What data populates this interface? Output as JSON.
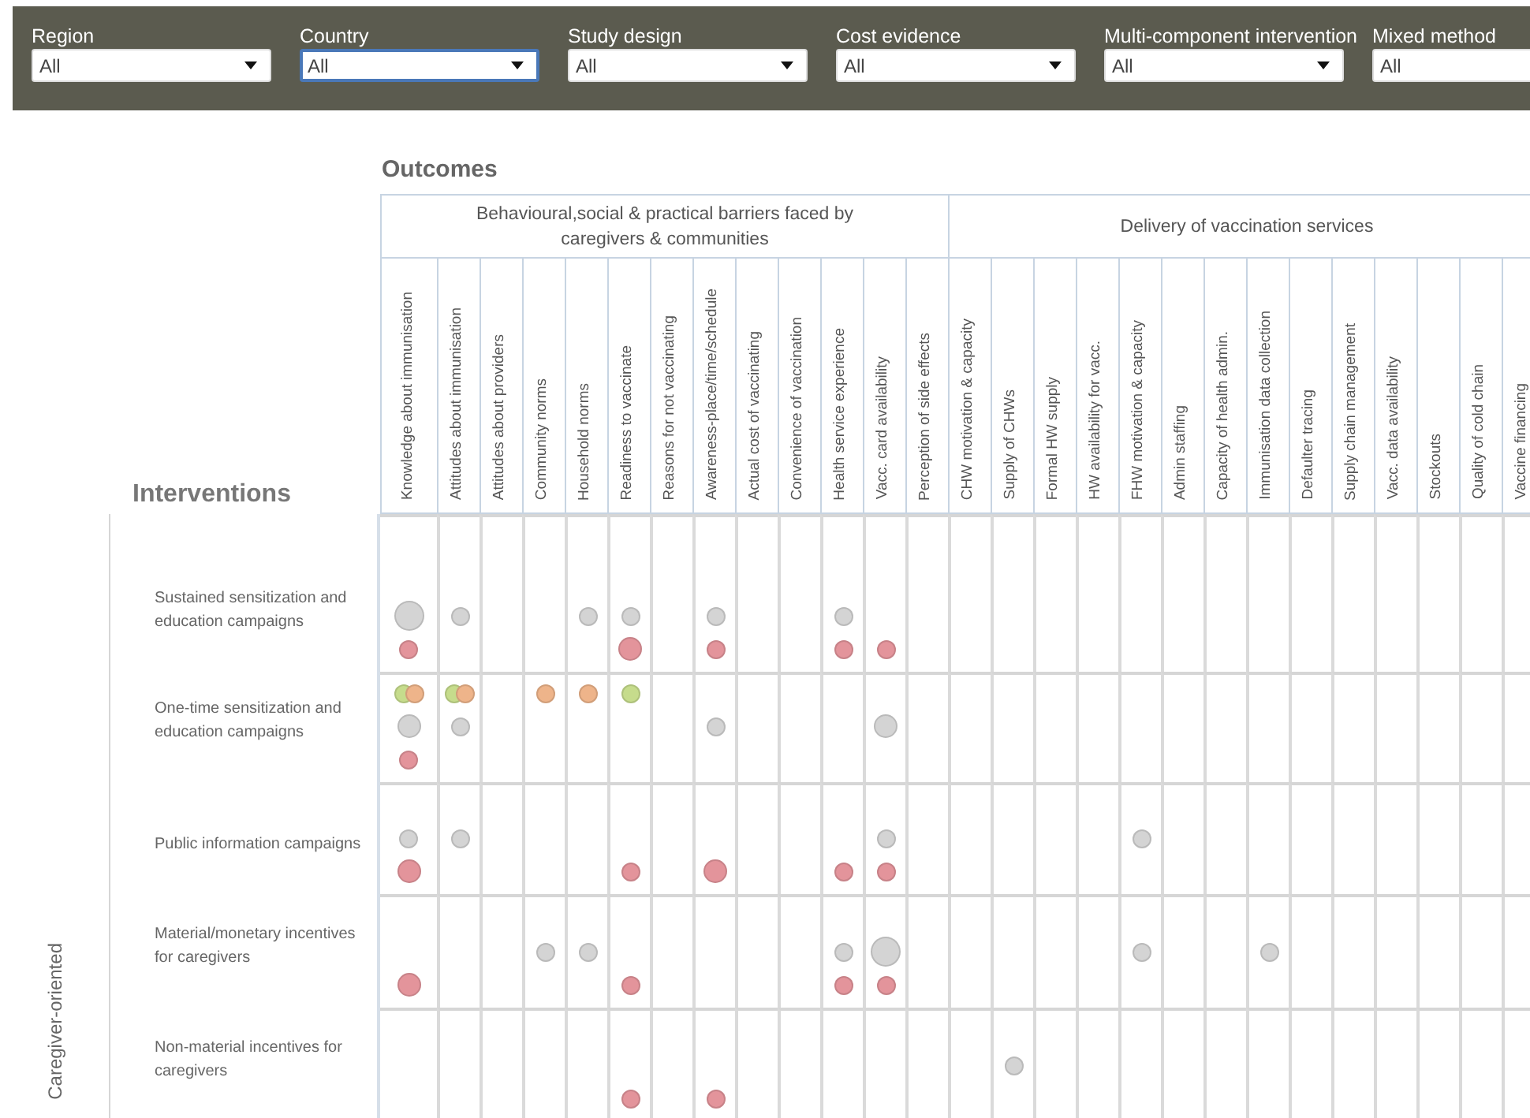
{
  "filters": [
    {
      "label": "Region",
      "value": "All",
      "focused": false
    },
    {
      "label": "Country",
      "value": "All",
      "focused": true
    },
    {
      "label": "Study design",
      "value": "All",
      "focused": false
    },
    {
      "label": "Cost evidence",
      "value": "All",
      "focused": false
    },
    {
      "label": "Multi-component intervention",
      "value": "All",
      "focused": false
    },
    {
      "label": "Mixed method",
      "value": "All",
      "focused": false
    }
  ],
  "outcomes_title": "Outcomes",
  "interventions_title": "Interventions",
  "outcome_groups": [
    {
      "title": "Behavioural,social & practical barriers faced by caregivers & communities",
      "columns": [
        "Knowledge about immunisation",
        "Attitudes about immunisation",
        "Attitudes about providers",
        "Community norms",
        "Household norms",
        "Readiness to vaccinate",
        "Reasons for not vaccinating",
        "Awareness-place/time/schedule",
        "Actual cost of vaccinating",
        "Convenience of vaccination",
        "Health service experience",
        "Vacc. card availability",
        "Perception of side effects"
      ]
    },
    {
      "title": "Delivery of vaccination services",
      "columns": [
        "CHW motivation & capacity",
        "Supply of CHWs",
        "Formal HW supply",
        "HW availability for vacc.",
        "FHW motivation & capacity",
        "Admin staffing",
        "Capacity of health admin.",
        "Immunisation data collection",
        "Defaulter tracing",
        "Supply chain management",
        "Vacc. data availability",
        "Stockouts",
        "Quality of cold chain",
        "Vaccine financing"
      ]
    }
  ],
  "intervention_groups": [
    {
      "title": "Caregiver-oriented",
      "rows": [
        {
          "label": "Sustained sensitization and education campaigns",
          "cells": [
            {
              "middle": [
                {
                  "color": "#d4d4d4",
                  "kind": "large"
                }
              ],
              "bottom": [
                {
                  "color": "#e3949b",
                  "kind": "small"
                }
              ]
            },
            {
              "middle": [
                {
                  "color": "#d4d4d4",
                  "kind": "small"
                }
              ]
            },
            {},
            {},
            {
              "middle": [
                {
                  "color": "#d4d4d4",
                  "kind": "small"
                }
              ]
            },
            {
              "middle": [
                {
                  "color": "#d4d4d4",
                  "kind": "small"
                }
              ],
              "bottom": [
                {
                  "color": "#e3949b",
                  "kind": "medium"
                }
              ]
            },
            {},
            {
              "middle": [
                {
                  "color": "#d4d4d4",
                  "kind": "small"
                }
              ],
              "bottom": [
                {
                  "color": "#e3949b",
                  "kind": "small"
                }
              ]
            },
            {},
            {},
            {
              "middle": [
                {
                  "color": "#d4d4d4",
                  "kind": "small"
                }
              ],
              "bottom": [
                {
                  "color": "#e3949b",
                  "kind": "small"
                }
              ]
            },
            {
              "bottom": [
                {
                  "color": "#e3949b",
                  "kind": "small"
                }
              ]
            },
            {},
            {},
            {},
            {},
            {},
            {},
            {},
            {},
            {},
            {},
            {},
            {},
            {},
            {},
            {}
          ]
        },
        {
          "label": "One-time sensitization and education campaigns",
          "cells": [
            {
              "top": [
                {
                  "color": "#c6dc8c",
                  "kind": "small"
                },
                {
                  "color": "#eeb48a",
                  "kind": "small"
                }
              ],
              "middle": [
                {
                  "color": "#d4d4d4",
                  "kind": "medium"
                }
              ],
              "bottom": [
                {
                  "color": "#e3949b",
                  "kind": "small"
                }
              ]
            },
            {
              "top": [
                {
                  "color": "#c6dc8c",
                  "kind": "small"
                },
                {
                  "color": "#eeb48a",
                  "kind": "small"
                }
              ],
              "middle": [
                {
                  "color": "#d4d4d4",
                  "kind": "small"
                }
              ]
            },
            {},
            {
              "top": [
                {
                  "color": "#eeb48a",
                  "kind": "small"
                }
              ]
            },
            {
              "top": [
                {
                  "color": "#eeb48a",
                  "kind": "small"
                }
              ]
            },
            {
              "top": [
                {
                  "color": "#c6dc8c",
                  "kind": "small"
                }
              ]
            },
            {},
            {
              "middle": [
                {
                  "color": "#d4d4d4",
                  "kind": "small"
                }
              ]
            },
            {},
            {},
            {},
            {
              "middle": [
                {
                  "color": "#d4d4d4",
                  "kind": "medium"
                }
              ]
            },
            {},
            {},
            {},
            {},
            {},
            {},
            {},
            {},
            {},
            {},
            {},
            {},
            {},
            {},
            {}
          ]
        },
        {
          "label": "Public information campaigns",
          "cells": [
            {
              "middle": [
                {
                  "color": "#d4d4d4",
                  "kind": "small"
                }
              ],
              "bottom": [
                {
                  "color": "#e3949b",
                  "kind": "medium"
                }
              ]
            },
            {
              "middle": [
                {
                  "color": "#d4d4d4",
                  "kind": "small"
                }
              ]
            },
            {},
            {},
            {},
            {
              "bottom": [
                {
                  "color": "#e3949b",
                  "kind": "small"
                }
              ]
            },
            {},
            {
              "bottom": [
                {
                  "color": "#e3949b",
                  "kind": "medium"
                }
              ]
            },
            {},
            {},
            {
              "bottom": [
                {
                  "color": "#e3949b",
                  "kind": "small"
                }
              ]
            },
            {
              "middle": [
                {
                  "color": "#d4d4d4",
                  "kind": "small"
                }
              ],
              "bottom": [
                {
                  "color": "#e3949b",
                  "kind": "small"
                }
              ]
            },
            {},
            {},
            {},
            {},
            {},
            {
              "middle": [
                {
                  "color": "#d4d4d4",
                  "kind": "small"
                }
              ]
            },
            {},
            {},
            {},
            {},
            {},
            {},
            {},
            {},
            {}
          ]
        },
        {
          "label": "Material/monetary incentives for caregivers",
          "cells": [
            {
              "bottom": [
                {
                  "color": "#e3949b",
                  "kind": "medium"
                }
              ]
            },
            {},
            {},
            {
              "middle": [
                {
                  "color": "#d4d4d4",
                  "kind": "small"
                }
              ]
            },
            {
              "middle": [
                {
                  "color": "#d4d4d4",
                  "kind": "small"
                }
              ]
            },
            {
              "bottom": [
                {
                  "color": "#e3949b",
                  "kind": "small"
                }
              ]
            },
            {},
            {},
            {},
            {},
            {
              "middle": [
                {
                  "color": "#d4d4d4",
                  "kind": "small"
                }
              ],
              "bottom": [
                {
                  "color": "#e3949b",
                  "kind": "small"
                }
              ]
            },
            {
              "middle": [
                {
                  "color": "#d4d4d4",
                  "kind": "large"
                }
              ],
              "bottom": [
                {
                  "color": "#e3949b",
                  "kind": "small"
                }
              ]
            },
            {},
            {},
            {},
            {},
            {},
            {
              "middle": [
                {
                  "color": "#d4d4d4",
                  "kind": "small"
                }
              ]
            },
            {},
            {},
            {
              "middle": [
                {
                  "color": "#d4d4d4",
                  "kind": "small"
                }
              ]
            },
            {},
            {},
            {},
            {},
            {},
            {}
          ]
        },
        {
          "label": "Non-material incentives for caregivers",
          "cells": [
            {},
            {},
            {},
            {},
            {},
            {
              "bottom": [
                {
                  "color": "#e3949b",
                  "kind": "small"
                }
              ]
            },
            {},
            {
              "bottom": [
                {
                  "color": "#e3949b",
                  "kind": "small"
                }
              ]
            },
            {},
            {},
            {},
            {},
            {},
            {},
            {
              "middle": [
                {
                  "color": "#d4d4d4",
                  "kind": "small"
                }
              ]
            },
            {},
            {},
            {},
            {},
            {},
            {},
            {},
            {},
            {},
            {},
            {},
            {}
          ]
        }
      ]
    }
  ]
}
